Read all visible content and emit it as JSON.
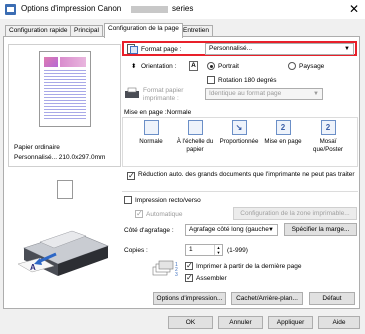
{
  "window": {
    "title_prefix": "Options d'impression Canon",
    "title_suffix": "series",
    "close_glyph": "✕"
  },
  "tabs": [
    {
      "label": "Configuration rapide"
    },
    {
      "label": "Principal"
    },
    {
      "label": "Configuration de la page"
    },
    {
      "label": "Entretien"
    }
  ],
  "preview": {
    "media_type": "Papier ordinaire",
    "size_info": "Personnalisé... 210.0x297.0mm"
  },
  "page_setup": {
    "format_label": "Format page :",
    "format_value": "Personnalisé...",
    "orientation_label": "Orientation :",
    "portrait_label": "Portrait",
    "landscape_label": "Paysage",
    "rotate_label": "Rotation 180 degrés",
    "paper_format_label_1": "Format papier",
    "paper_format_label_2": "imprimante :",
    "paper_format_value": "Identique au format page",
    "layout_label": "Mise en page :Normale",
    "layouts": [
      {
        "label": "Normale",
        "icon": "normal-layout-icon",
        "glyph": ""
      },
      {
        "label": "À l'échelle du papier",
        "icon": "fit-to-page-icon",
        "glyph": ""
      },
      {
        "label": "Proportionnée",
        "icon": "scaled-layout-icon",
        "glyph": "↘"
      },
      {
        "label": "Mise en page",
        "icon": "page-layout-icon",
        "glyph": "2"
      },
      {
        "label": "Mosaï que/Poster",
        "icon": "tiling-poster-icon",
        "glyph": "2"
      }
    ],
    "reduce_label": "Réduction auto. des grands documents que l'imprimante ne peut pas traiter",
    "duplex_label": "Impression recto/verso",
    "automatic_label": "Automatique",
    "print_area_button": "Configuration de la zone imprimable...",
    "stapling_label": "Côté d'agrafage :",
    "stapling_value": "Agrafage côté long (gauche",
    "margin_button": "Spécifier la marge...",
    "copies_label": "Copies :",
    "copies_value": "1",
    "copies_range": "(1-999)",
    "last_page_first_label": "Imprimer à partir de la dernière page",
    "collate_label": "Assembler",
    "options_button": "Options d'impression...",
    "stamp_button": "Cachet/Arrière-plan...",
    "default_button": "Défaut"
  },
  "footer": {
    "ok": "OK",
    "cancel": "Annuler",
    "apply": "Appliquer",
    "help": "Aide"
  },
  "colors": {
    "highlight_border": "#e8202a",
    "accent": "#3e70c0"
  }
}
